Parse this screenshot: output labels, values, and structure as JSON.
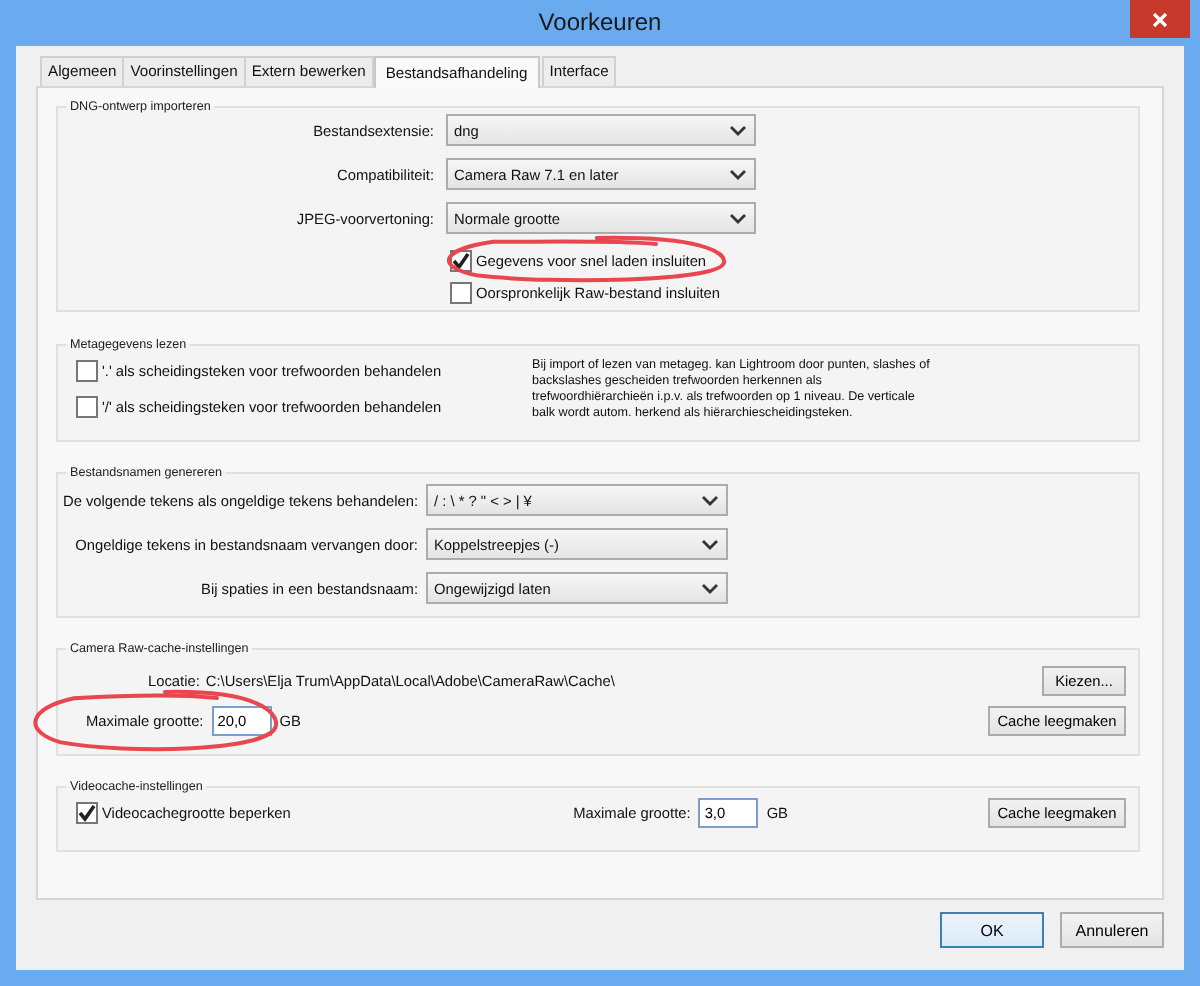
{
  "window": {
    "title": "Voorkeuren"
  },
  "tabs": [
    {
      "label": "Algemeen",
      "selected": false
    },
    {
      "label": "Voorinstellingen",
      "selected": false
    },
    {
      "label": "Extern bewerken",
      "selected": false
    },
    {
      "label": "Bestandsafhandeling",
      "selected": true
    },
    {
      "label": "Interface",
      "selected": false
    }
  ],
  "dng_import": {
    "title": "DNG-ontwerp importeren",
    "selects": [
      {
        "label": "Bestandsextensie:",
        "value": "dng"
      },
      {
        "label": "Compatibiliteit:",
        "value": "Camera Raw 7.1 en later"
      },
      {
        "label": "JPEG-voorvertoning:",
        "value": "Normale grootte"
      }
    ],
    "checkboxes": [
      {
        "label": "Gegevens voor snel laden insluiten",
        "checked": true,
        "highlighted": true
      },
      {
        "label": "Oorspronkelijk Raw-bestand insluiten",
        "checked": false,
        "highlighted": false
      }
    ]
  },
  "metadata": {
    "title": "Metagegevens lezen",
    "checkboxes": [
      {
        "label": "'.' als scheidingsteken voor trefwoorden behandelen",
        "checked": false
      },
      {
        "label": "'/' als scheidingsteken voor trefwoorden behandelen",
        "checked": false
      }
    ],
    "note": "Bij import of lezen van metageg. kan Lightroom door punten, slashes of backslashes gescheiden trefwoorden herkennen als trefwoordhiërarchieën i.p.v. als trefwoorden op 1 niveau. De verticale balk wordt autom. herkend als hiërarchiescheidingsteken."
  },
  "file_names": {
    "title": "Bestandsnamen genereren",
    "selects": [
      {
        "label": "De volgende tekens als ongeldige tekens behandelen:",
        "value": "/ : \\ * ? \" < > | ¥"
      },
      {
        "label": "Ongeldige tekens in bestandsnaam vervangen door:",
        "value": "Koppelstreepjes (-)"
      },
      {
        "label": "Bij spaties in een bestandsnaam:",
        "value": "Ongewijzigd laten"
      }
    ]
  },
  "camera_raw_cache": {
    "title": "Camera Raw-cache-instellingen",
    "location_label": "Locatie:",
    "location": "C:\\Users\\Elja Trum\\AppData\\Local\\Adobe\\CameraRaw\\Cache\\",
    "choose_button": "Kiezen...",
    "max_size": {
      "label": "Maximale grootte:",
      "value": "20,0",
      "unit": "GB",
      "highlighted": true
    },
    "clear_button": "Cache leegmaken"
  },
  "video_cache": {
    "title": "Videocache-instellingen",
    "checkbox": {
      "label": "Videocachegrootte beperken",
      "checked": true
    },
    "max_size": {
      "label": "Maximale grootte:",
      "value": "3,0",
      "unit": "GB"
    },
    "clear_button": "Cache leegmaken"
  },
  "buttons": [
    {
      "label": "OK",
      "default": true
    },
    {
      "label": "Annuleren",
      "default": false
    }
  ]
}
